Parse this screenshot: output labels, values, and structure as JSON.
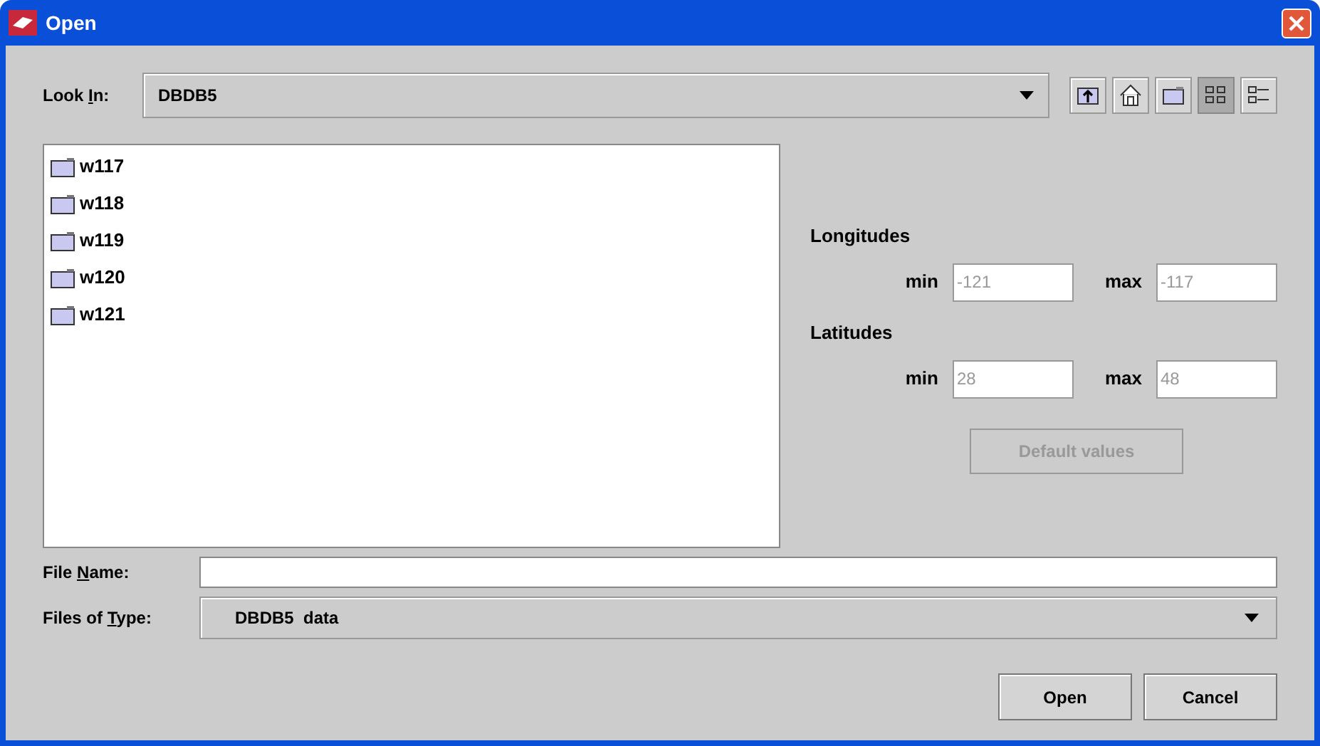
{
  "window": {
    "title": "Open"
  },
  "look_in": {
    "label": [
      {
        "text": "Look "
      },
      {
        "text": "I",
        "mnemonic": true
      },
      {
        "text": "n:"
      }
    ],
    "value": "DBDB5"
  },
  "toolbar": [
    {
      "kind": "up",
      "selected": false
    },
    {
      "kind": "home",
      "selected": false
    },
    {
      "kind": "new-folder",
      "selected": false
    },
    {
      "kind": "list",
      "selected": true
    },
    {
      "kind": "details",
      "selected": false
    }
  ],
  "files": [
    {
      "name": "w117"
    },
    {
      "name": "w118"
    },
    {
      "name": "w119"
    },
    {
      "name": "w120"
    },
    {
      "name": "w121"
    }
  ],
  "longitudes": {
    "title": "Longitudes",
    "min_label": "min",
    "min": "-121",
    "max_label": "max",
    "max": "-117",
    "disabled": true
  },
  "latitudes": {
    "title": "Latitudes",
    "min_label": "min",
    "min": "28",
    "max_label": "max",
    "max": "48",
    "disabled": true
  },
  "default_button": {
    "label": "Default values",
    "disabled": true
  },
  "file_name": {
    "label": [
      {
        "text": "File "
      },
      {
        "text": "N",
        "mnemonic": true
      },
      {
        "text": "ame:"
      }
    ]
  },
  "file_type": {
    "label": [
      {
        "text": "Files of "
      },
      {
        "text": "T",
        "mnemonic": true
      },
      {
        "text": "ype:"
      }
    ],
    "value": "DBDB5  data"
  },
  "buttons": [
    {
      "label": "Open"
    },
    {
      "label": "Cancel"
    }
  ]
}
